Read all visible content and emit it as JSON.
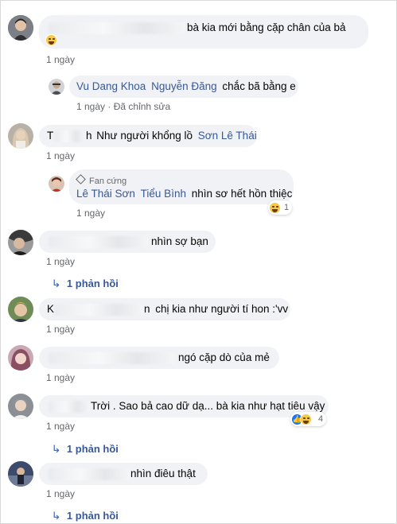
{
  "comments": [
    {
      "text": "bà kia mới bằng cặp chân của bả",
      "time": "1 ngày",
      "reaction_count": ""
    },
    {
      "name": "Vu Dang Khoa",
      "mention": "Nguyễn Đăng",
      "text": "chắc bã bằng e",
      "time": "1 ngày",
      "edited": "Đã chỉnh sửa"
    },
    {
      "name_start": "T",
      "name_end": "h",
      "text": "Như người khổng lồ",
      "mention": "Sơn Lê Thái",
      "time": "1 ngày"
    },
    {
      "badge": "Fan cứng",
      "name": "Lê Thái Sơn",
      "mention": "Tiểu Bình",
      "text": "nhìn sơ hết hồn thiệc",
      "time": "1 ngày",
      "reaction_count": "1"
    },
    {
      "text": "nhìn sợ bạn",
      "time": "1 ngày",
      "replies": "1 phản hồi"
    },
    {
      "name_start": "K",
      "name_end": "n",
      "text": "chị kia như người tí hon :'vv",
      "time": "1 ngày"
    },
    {
      "text": "ngó cặp dò của mẻ",
      "time": "1 ngày"
    },
    {
      "text": "Trời . Sao bả cao dữ dạ... bà kia như hạt tiêu vậy",
      "time": "1 ngày",
      "reaction_count": "4",
      "replies": "1 phản hồi"
    },
    {
      "text": "nhìn điêu thật",
      "time": "1 ngày",
      "replies": "1 phản hồi"
    }
  ],
  "colors": {
    "bubble": "#f0f2f5",
    "link": "#385898",
    "meta": "#65676b"
  },
  "icons": {
    "reply_arrow": "reply-arrow-icon",
    "haha": "haha-reaction-icon",
    "like": "like-reaction-icon",
    "fan_badge": "diamond-icon"
  }
}
